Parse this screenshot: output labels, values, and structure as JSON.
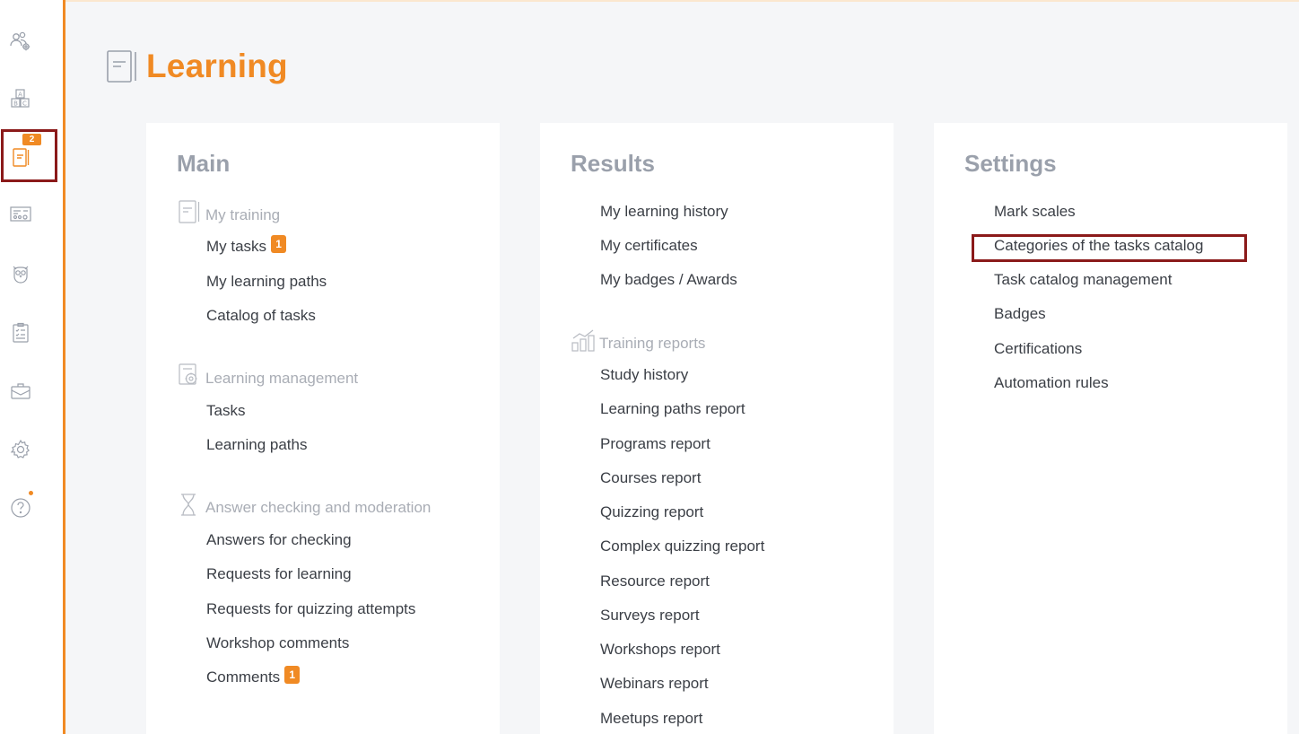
{
  "app": {
    "page_title": "Learning",
    "accent_color": "#f08a24",
    "highlight_color": "#8b1a1a"
  },
  "sidebar": {
    "items": [
      {
        "icon": "users-gear-icon"
      },
      {
        "icon": "abc-blocks-icon"
      },
      {
        "icon": "learning-book-icon",
        "badge": "2",
        "active": true
      },
      {
        "icon": "dashboard-screen-icon"
      },
      {
        "icon": "owl-icon"
      },
      {
        "icon": "clipboard-checklist-icon"
      },
      {
        "icon": "briefcase-icon"
      },
      {
        "icon": "gear-icon"
      },
      {
        "icon": "help-icon",
        "notification_dot": true
      }
    ]
  },
  "main": {
    "title": "Main",
    "groups": [
      {
        "label": "My training",
        "icon": "book-icon",
        "items": [
          {
            "label": "My tasks",
            "badge": "1"
          },
          {
            "label": "My learning paths"
          },
          {
            "label": "Catalog of tasks"
          }
        ]
      },
      {
        "label": "Learning management",
        "icon": "book-gear-icon",
        "items": [
          {
            "label": "Tasks"
          },
          {
            "label": "Learning paths"
          }
        ]
      },
      {
        "label": "Answer checking and moderation",
        "icon": "hourglass-icon",
        "items": [
          {
            "label": "Answers for checking"
          },
          {
            "label": "Requests for learning"
          },
          {
            "label": "Requests for quizzing attempts"
          },
          {
            "label": "Workshop comments"
          },
          {
            "label": "Comments",
            "badge": "1"
          }
        ]
      }
    ]
  },
  "results": {
    "title": "Results",
    "items": [
      {
        "label": "My learning history"
      },
      {
        "label": "My certificates"
      },
      {
        "label": "My badges / Awards"
      }
    ],
    "reports_group": {
      "label": "Training reports",
      "icon": "bar-chart-icon",
      "items": [
        {
          "label": "Study history"
        },
        {
          "label": "Learning paths report"
        },
        {
          "label": "Programs report"
        },
        {
          "label": "Courses report"
        },
        {
          "label": "Quizzing report"
        },
        {
          "label": "Complex quizzing report"
        },
        {
          "label": "Resource report"
        },
        {
          "label": "Surveys report"
        },
        {
          "label": "Workshops report"
        },
        {
          "label": "Webinars report"
        },
        {
          "label": "Meetups report"
        }
      ]
    }
  },
  "settings": {
    "title": "Settings",
    "items": [
      {
        "label": "Mark scales"
      },
      {
        "label": "Categories of the tasks catalog",
        "highlighted": true
      },
      {
        "label": "Task catalog management"
      },
      {
        "label": "Badges"
      },
      {
        "label": "Certifications"
      },
      {
        "label": "Automation rules"
      }
    ]
  }
}
